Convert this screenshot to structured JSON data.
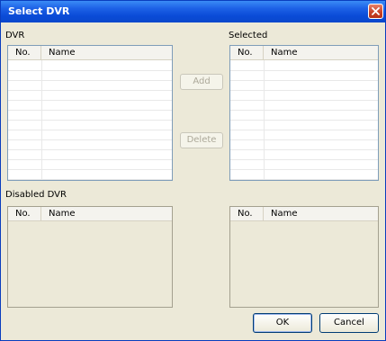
{
  "window": {
    "title": "Select DVR"
  },
  "dvr": {
    "label": "DVR",
    "columns": [
      "No.",
      "Name"
    ]
  },
  "selected": {
    "label": "Selected",
    "columns": [
      "No.",
      "Name"
    ]
  },
  "disabled_dvr": {
    "label": "Disabled DVR",
    "columns": [
      "No.",
      "Name"
    ]
  },
  "disabled_right": {
    "columns": [
      "No.",
      "Name"
    ]
  },
  "buttons": {
    "add": "Add",
    "delete": "Delete",
    "ok": "OK",
    "cancel": "Cancel"
  },
  "icons": {
    "close": "close-icon"
  },
  "colors": {
    "titlebar": "#0a4bd7",
    "close": "#c9442a",
    "dialog_bg": "#ece9d8",
    "list_border": "#7f9db9"
  }
}
